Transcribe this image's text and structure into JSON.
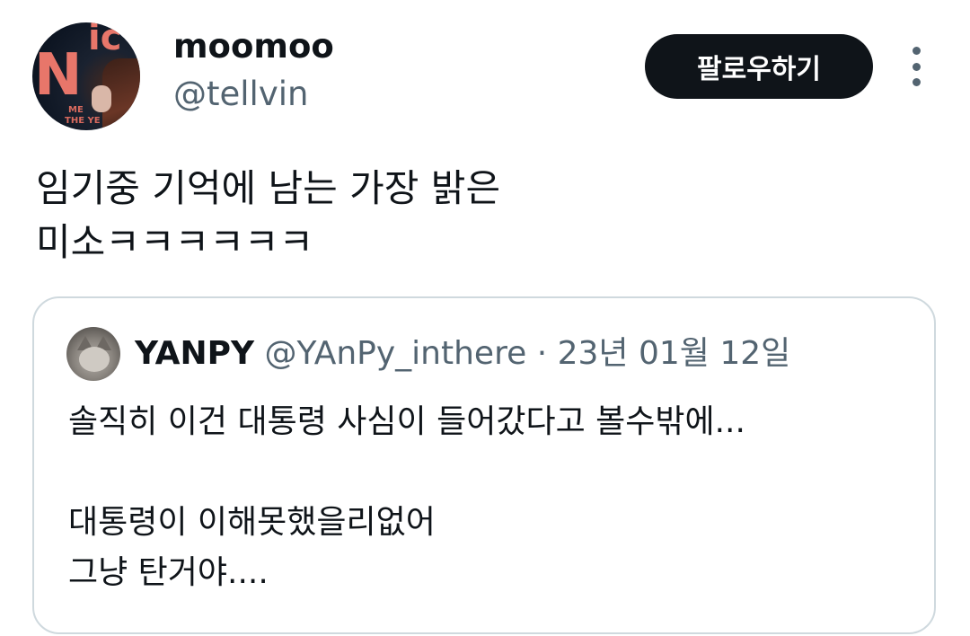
{
  "author": {
    "name": "moomoo",
    "handle": "@tellvin",
    "avatar_lettering": [
      "N",
      "ic",
      "ME",
      "THE YE"
    ]
  },
  "follow_button": {
    "label": "팔로우하기"
  },
  "more_menu": {
    "icon": "more-vertical-icon"
  },
  "tweet": {
    "lines": [
      "임기중 기억에 남는 가장 밝은",
      "미소ㅋㅋㅋㅋㅋㅋ"
    ]
  },
  "quoted_tweet": {
    "name": "YANPY",
    "handle": "@YAnPy_inthere",
    "separator": "·",
    "date": "23년 01월 12일",
    "lines": [
      "솔직히 이건 대통령 사심이 들어갔다고 볼수밖에...",
      "",
      "대통령이 이해못했을리없어",
      "그냥 탄거야...."
    ]
  },
  "colors": {
    "text_primary": "#0f1419",
    "text_secondary": "#536471",
    "button_bg": "#0f1419",
    "border": "#cfd9de"
  }
}
